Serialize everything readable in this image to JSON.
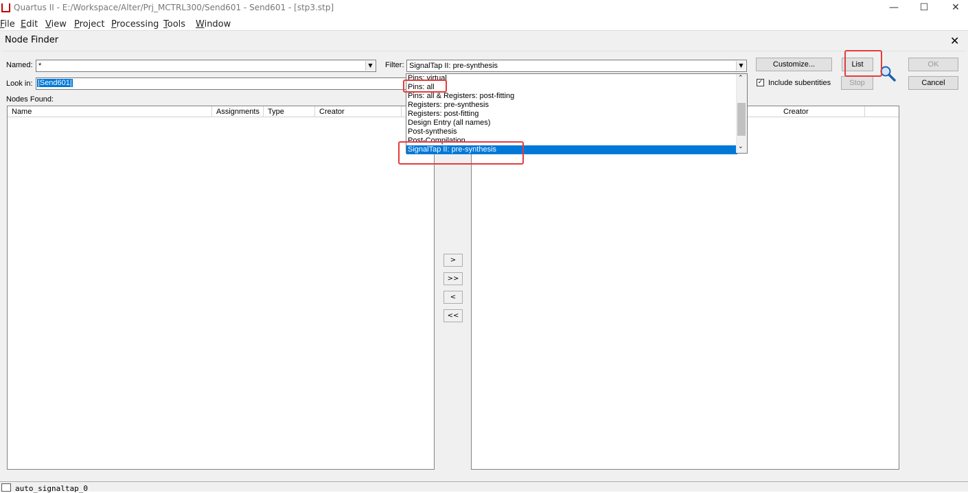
{
  "app": {
    "title": "Quartus II - E:/Workspace/Alter/Prj_MCTRL300/Send601 - Send601 - [stp3.stp]",
    "minimize": "—",
    "maximize": "☐",
    "close": "✕"
  },
  "menubar": [
    {
      "label": "ile",
      "u": "F"
    },
    {
      "label": "dit",
      "u": "E"
    },
    {
      "label": "iew",
      "u": "V"
    },
    {
      "label": "roject",
      "u": "P"
    },
    {
      "label": "rocessing",
      "u": "P"
    },
    {
      "label": "ools",
      "u": "T"
    },
    {
      "label": "indow",
      "u": "W"
    }
  ],
  "dialog": {
    "title": "Node Finder",
    "close": "✕",
    "named_label": "Named:",
    "named_value": "*",
    "filter_label": "Filter:",
    "filter_value": "SignalTap II: pre-synthesis",
    "lookin_label": "Look in:",
    "lookin_value": "|Send601|",
    "nodes_found_label": "Nodes Found:",
    "customize_label": "Customize...",
    "list_label": "List",
    "stop_label": "Stop",
    "ok_label": "OK",
    "cancel_label": "Cancel",
    "include_subentities_label": "Include subentities",
    "include_subentities_checked": true,
    "left_columns": [
      "Name",
      "Assignments",
      "Type",
      "Creator"
    ],
    "right_columns": [
      "Creator"
    ],
    "move_buttons": [
      ">",
      ">>",
      "<",
      "<<"
    ],
    "filter_options": [
      "Pins: virtual",
      "Pins: all",
      "Pins: all & Registers: post-fitting",
      "Registers: pre-synthesis",
      "Registers: post-fitting",
      "Design Entry (all names)",
      "Post-synthesis",
      "Post-Compilation",
      "SignalTap II: pre-synthesis"
    ],
    "selected_option_index": 8
  },
  "status": {
    "text": "auto_signaltap_0"
  },
  "colors": {
    "highlight": "#0078d7",
    "annotation": "#e53b3b"
  }
}
